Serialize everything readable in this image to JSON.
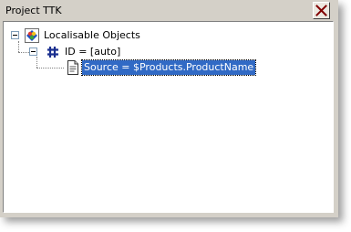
{
  "window": {
    "title": "Project TTK"
  },
  "tree": {
    "root": {
      "label": "Localisable Objects",
      "icon": "localisable-objects-icon"
    },
    "child": {
      "label": "ID = [auto]",
      "icon": "hash-icon"
    },
    "leaf": {
      "label": "Source = $Products.ProductName",
      "icon": "document-icon",
      "selected": true
    }
  },
  "colors": {
    "panel": "#d4d0c8",
    "selection": "#316ac5",
    "close_x": "#800000"
  }
}
